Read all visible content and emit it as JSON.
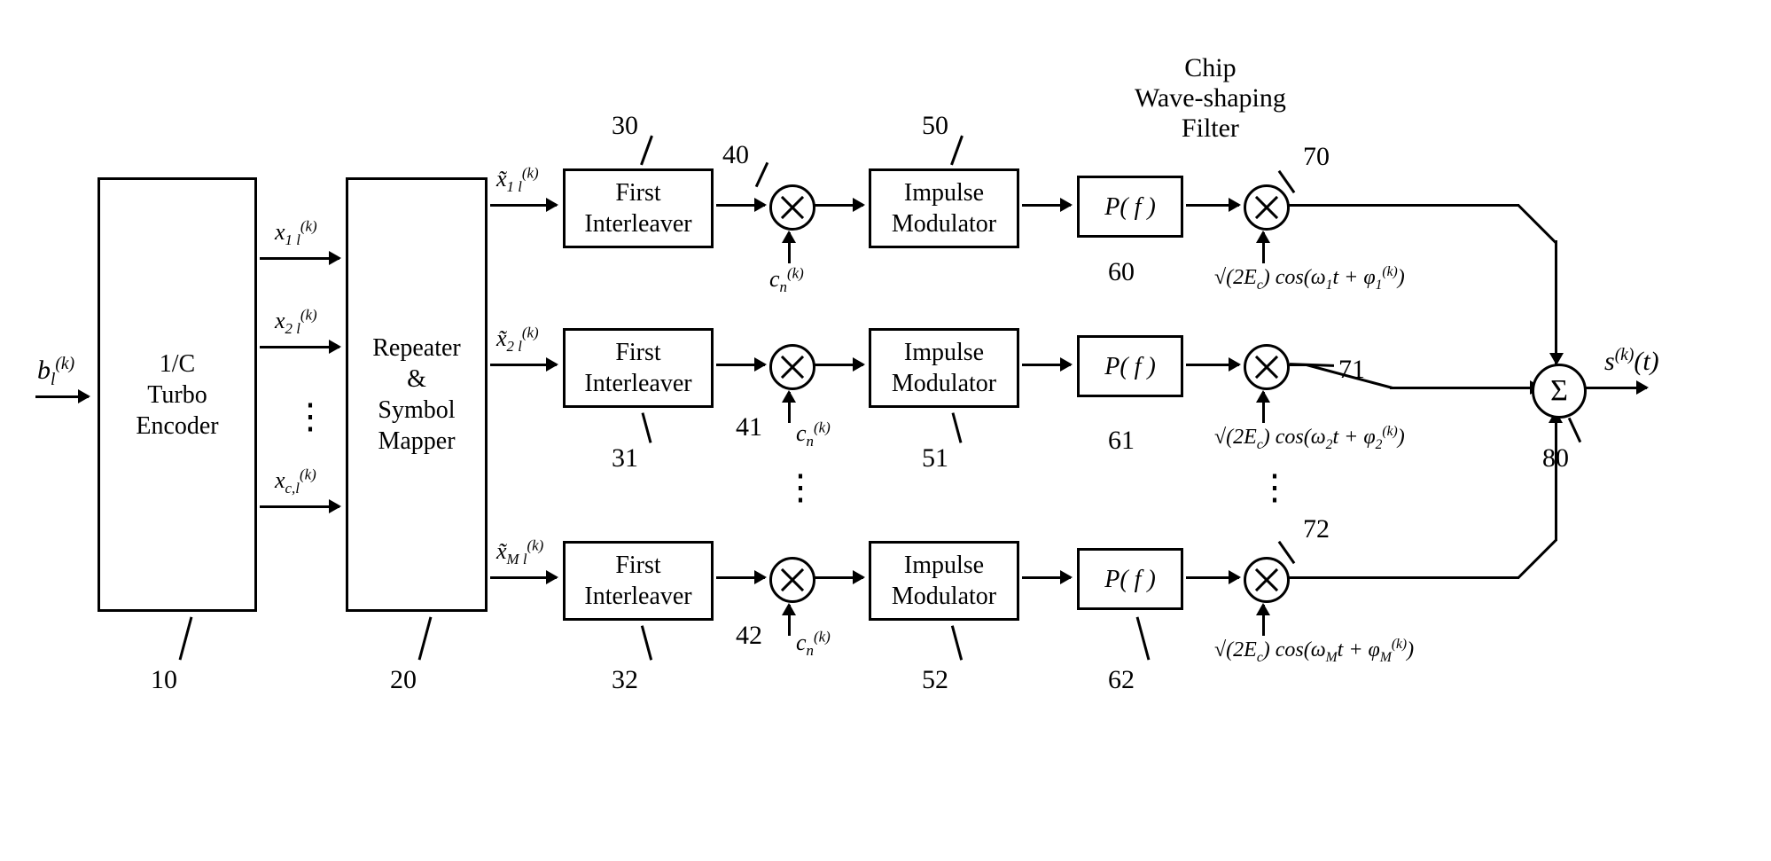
{
  "input_label": "b<sub>l</sub><sup>(k)</sup>",
  "encoder": {
    "label": "1/C\nTurbo\nEncoder",
    "ref": "10"
  },
  "encoder_outputs": {
    "x1": "x<sub>1 l</sub><sup>(k)</sup>",
    "x2": "x<sub>2 l</sub><sup>(k)</sup>",
    "xc": "x<sub>c,l</sub><sup>(k)</sup>"
  },
  "repeater": {
    "label": "Repeater\n&\nSymbol\nMapper",
    "ref": "20"
  },
  "row_signals": {
    "xt1": "x̃<sub>1 l</sub><sup>(k)</sup>",
    "xt2": "x̃<sub>2 l</sub><sup>(k)</sup>",
    "xtM": "x̃<sub>M l</sub><sup>(k)</sup>"
  },
  "interleaver": {
    "label": "First\nInterleaver",
    "refs": [
      "30",
      "31",
      "32"
    ]
  },
  "mixer1": {
    "refs": [
      "40",
      "41",
      "42"
    ],
    "code_label": "c<sub>n</sub><sup>(k)</sup>"
  },
  "impulse": {
    "label": "Impulse\nModulator",
    "refs": [
      "50",
      "51",
      "52"
    ]
  },
  "filter": {
    "title": "Chip\nWave-shaping\nFilter",
    "label": "P( f )",
    "refs": [
      "60",
      "61",
      "62"
    ]
  },
  "mixer2": {
    "refs": [
      "70",
      "71",
      "72"
    ],
    "carriers": [
      "√(2E<sub>c</sub>) cos(ω<sub>1</sub>t + φ<sub>1</sub><sup>(k)</sup>)",
      "√(2E<sub>c</sub>) cos(ω<sub>2</sub>t + φ<sub>2</sub><sup>(k)</sup>)",
      "√(2E<sub>c</sub>) cos(ω<sub>M</sub>t + φ<sub>M</sub><sup>(k)</sup>)"
    ]
  },
  "summer": {
    "label": "Σ",
    "ref": "80"
  },
  "output_label": "s<sup>(k)</sup>(t)",
  "chart_data": {
    "type": "block-diagram",
    "input": "b_l^(k)",
    "blocks_chain_per_row": [
      "First Interleaver",
      "Mixer (× c_n^(k))",
      "Impulse Modulator",
      "Chip Wave-shaping Filter P(f)",
      "Carrier Mixer"
    ],
    "rows": "M (shown 1, 2, …, M)",
    "front_blocks": [
      "1/C Turbo Encoder",
      "Repeater & Symbol Mapper"
    ],
    "combine": "Σ → s^(k)(t)"
  }
}
